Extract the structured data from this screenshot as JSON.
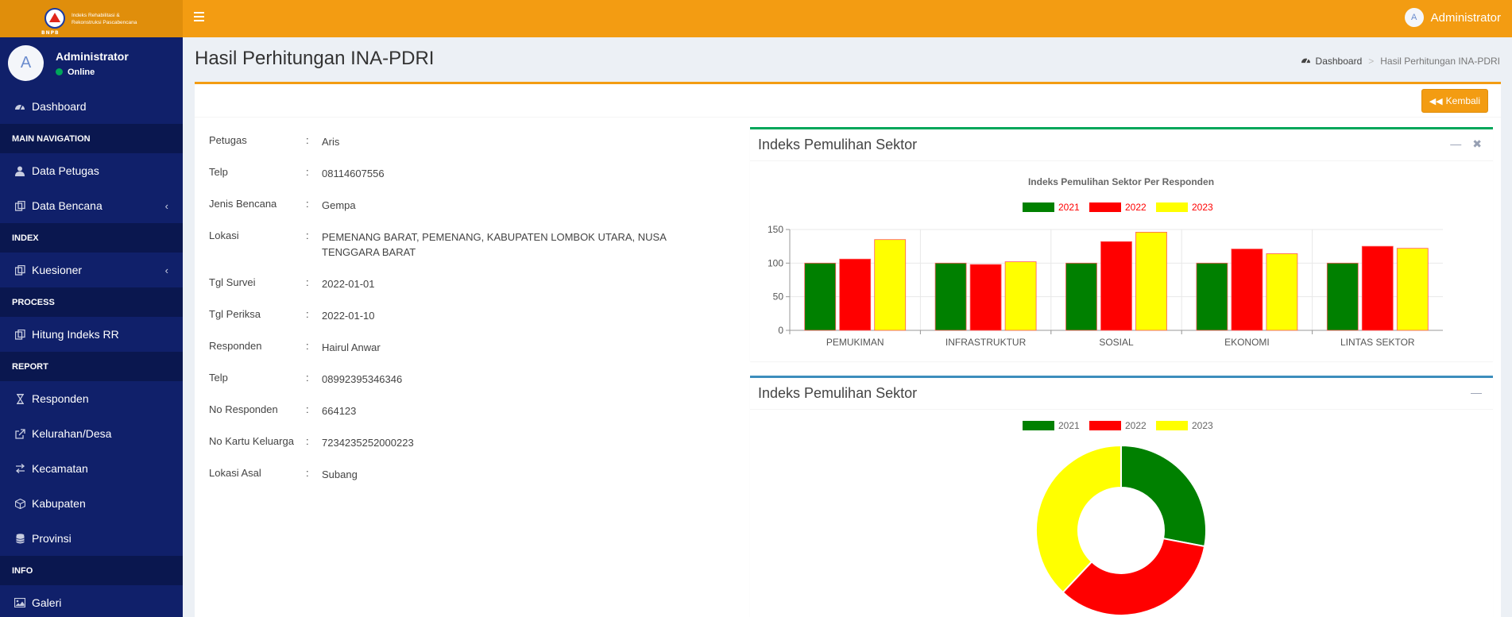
{
  "header": {
    "logo_text": "Indeks Rehabilitasi & Rekonstruksi Pascabencana",
    "logo_badge": "BNPB",
    "user_name": "Administrator",
    "avatar_letter": "A"
  },
  "sidebar": {
    "user": {
      "name": "Administrator",
      "status": "Online",
      "avatar_letter": "A"
    },
    "dashboard": "Dashboard",
    "h_main": "MAIN NAVIGATION",
    "data_petugas": "Data Petugas",
    "data_bencana": "Data Bencana",
    "h_index": "INDEX",
    "kuesioner": "Kuesioner",
    "h_process": "PROCESS",
    "hitung": "Hitung Indeks RR",
    "h_report": "REPORT",
    "responden": "Responden",
    "kelurahan": "Kelurahan/Desa",
    "kecamatan": "Kecamatan",
    "kabupaten": "Kabupaten",
    "provinsi": "Provinsi",
    "h_info": "INFO",
    "galeri": "Galeri"
  },
  "page": {
    "title": "Hasil Perhitungan INA-PDRI",
    "breadcrumb_home": "Dashboard",
    "breadcrumb_current": "Hasil Perhitungan INA-PDRI",
    "back_button": "Kembali"
  },
  "details": [
    {
      "label": "Petugas",
      "value": "Aris"
    },
    {
      "label": "Telp",
      "value": "08114607556"
    },
    {
      "label": "Jenis Bencana",
      "value": "Gempa"
    },
    {
      "label": "Lokasi",
      "value": "PEMENANG BARAT, PEMENANG, KABUPATEN LOMBOK UTARA, NUSA TENGGARA BARAT"
    },
    {
      "label": "Tgl Survei",
      "value": "2022-01-01"
    },
    {
      "label": "Tgl Periksa",
      "value": "2022-01-10"
    },
    {
      "label": "Responden",
      "value": "Hairul Anwar"
    },
    {
      "label": "Telp",
      "value": "08992395346346"
    },
    {
      "label": "No Responden",
      "value": "664123"
    },
    {
      "label": "No Kartu Keluarga",
      "value": "7234235252000223"
    },
    {
      "label": "Lokasi Asal",
      "value": "Subang"
    }
  ],
  "panels": {
    "bar_title": "Indeks Pemulihan Sektor",
    "pie_title": "Indeks Pemulihan Sektor",
    "bar_color": "#00a65a",
    "pie_color": "#3c8dbc"
  },
  "chart_data": [
    {
      "type": "bar",
      "title": "Indeks Pemulihan Sektor Per Responden",
      "categories": [
        "PEMUKIMAN",
        "INFRASTRUKTUR",
        "SOSIAL",
        "EKONOMI",
        "LINTAS SEKTOR"
      ],
      "series": [
        {
          "name": "2021",
          "color": "#008000",
          "values": [
            100,
            100,
            100,
            100,
            100
          ]
        },
        {
          "name": "2022",
          "color": "#ff0000",
          "values": [
            106,
            98,
            132,
            121,
            125
          ]
        },
        {
          "name": "2023",
          "color": "#ffff00",
          "values": [
            135,
            102,
            146,
            114,
            122
          ]
        }
      ],
      "ylim": [
        0,
        150
      ],
      "yticks": [
        0,
        50,
        100,
        150
      ],
      "legend": "top",
      "grid": true
    },
    {
      "type": "pie",
      "labels": [
        "2021",
        "2022",
        "2023"
      ],
      "colors": [
        "#008000",
        "#ff0000",
        "#ffff00"
      ],
      "values": [
        28,
        34,
        38
      ],
      "legend": "top"
    }
  ]
}
